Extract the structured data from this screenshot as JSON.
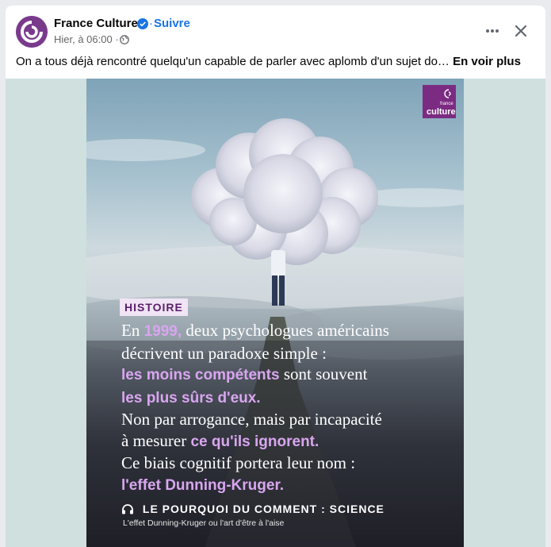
{
  "post": {
    "page_name": "France Culture",
    "follow_separator": "·",
    "follow_label": "Suivre",
    "timestamp": "Hier, à 06:00 ·",
    "text": "On a tous déjà rencontré quelqu'un capable de parler avec aplomb d'un sujet do…",
    "see_more": "En voir plus"
  },
  "icons": {
    "avatar": "france-culture-logo-icon",
    "verified": "verified-badge-icon",
    "audience": "globe-icon",
    "more": "more-options-icon",
    "close": "close-icon",
    "headphones": "headphones-icon"
  },
  "poster": {
    "logo_small": "france",
    "logo_big": "culture",
    "tag": "HISTOIRE",
    "lines": [
      [
        {
          "t": "En ",
          "h": false
        },
        {
          "t": "1999,",
          "h": true
        },
        {
          "t": " deux psychologues américains",
          "h": false
        }
      ],
      [
        {
          "t": "décrivent un paradoxe simple :",
          "h": false
        }
      ],
      [
        {
          "t": "les moins compétents",
          "h": true
        },
        {
          "t": " sont souvent",
          "h": false
        }
      ],
      [
        {
          "t": "les plus sûrs d'eux.",
          "h": true
        }
      ],
      [
        {
          "t": "Non par arrogance, mais par incapacité",
          "h": false
        }
      ],
      [
        {
          "t": "à mesurer ",
          "h": false
        },
        {
          "t": "ce qu'ils ignorent.",
          "h": true
        }
      ],
      [
        {
          "t": "Ce biais cognitif portera leur nom :",
          "h": false
        }
      ],
      [
        {
          "t": "l'effet Dunning-Kruger.",
          "h": true
        }
      ]
    ],
    "show_title": "LE POURQUOI DU COMMENT : SCIENCE",
    "show_subtitle": "L'effet Dunning-Kruger ou l'art d'être à l'aise"
  },
  "colors": {
    "accent": "#1b74e4",
    "brand": "#7b2c82",
    "highlight": "#d9a6f0"
  }
}
